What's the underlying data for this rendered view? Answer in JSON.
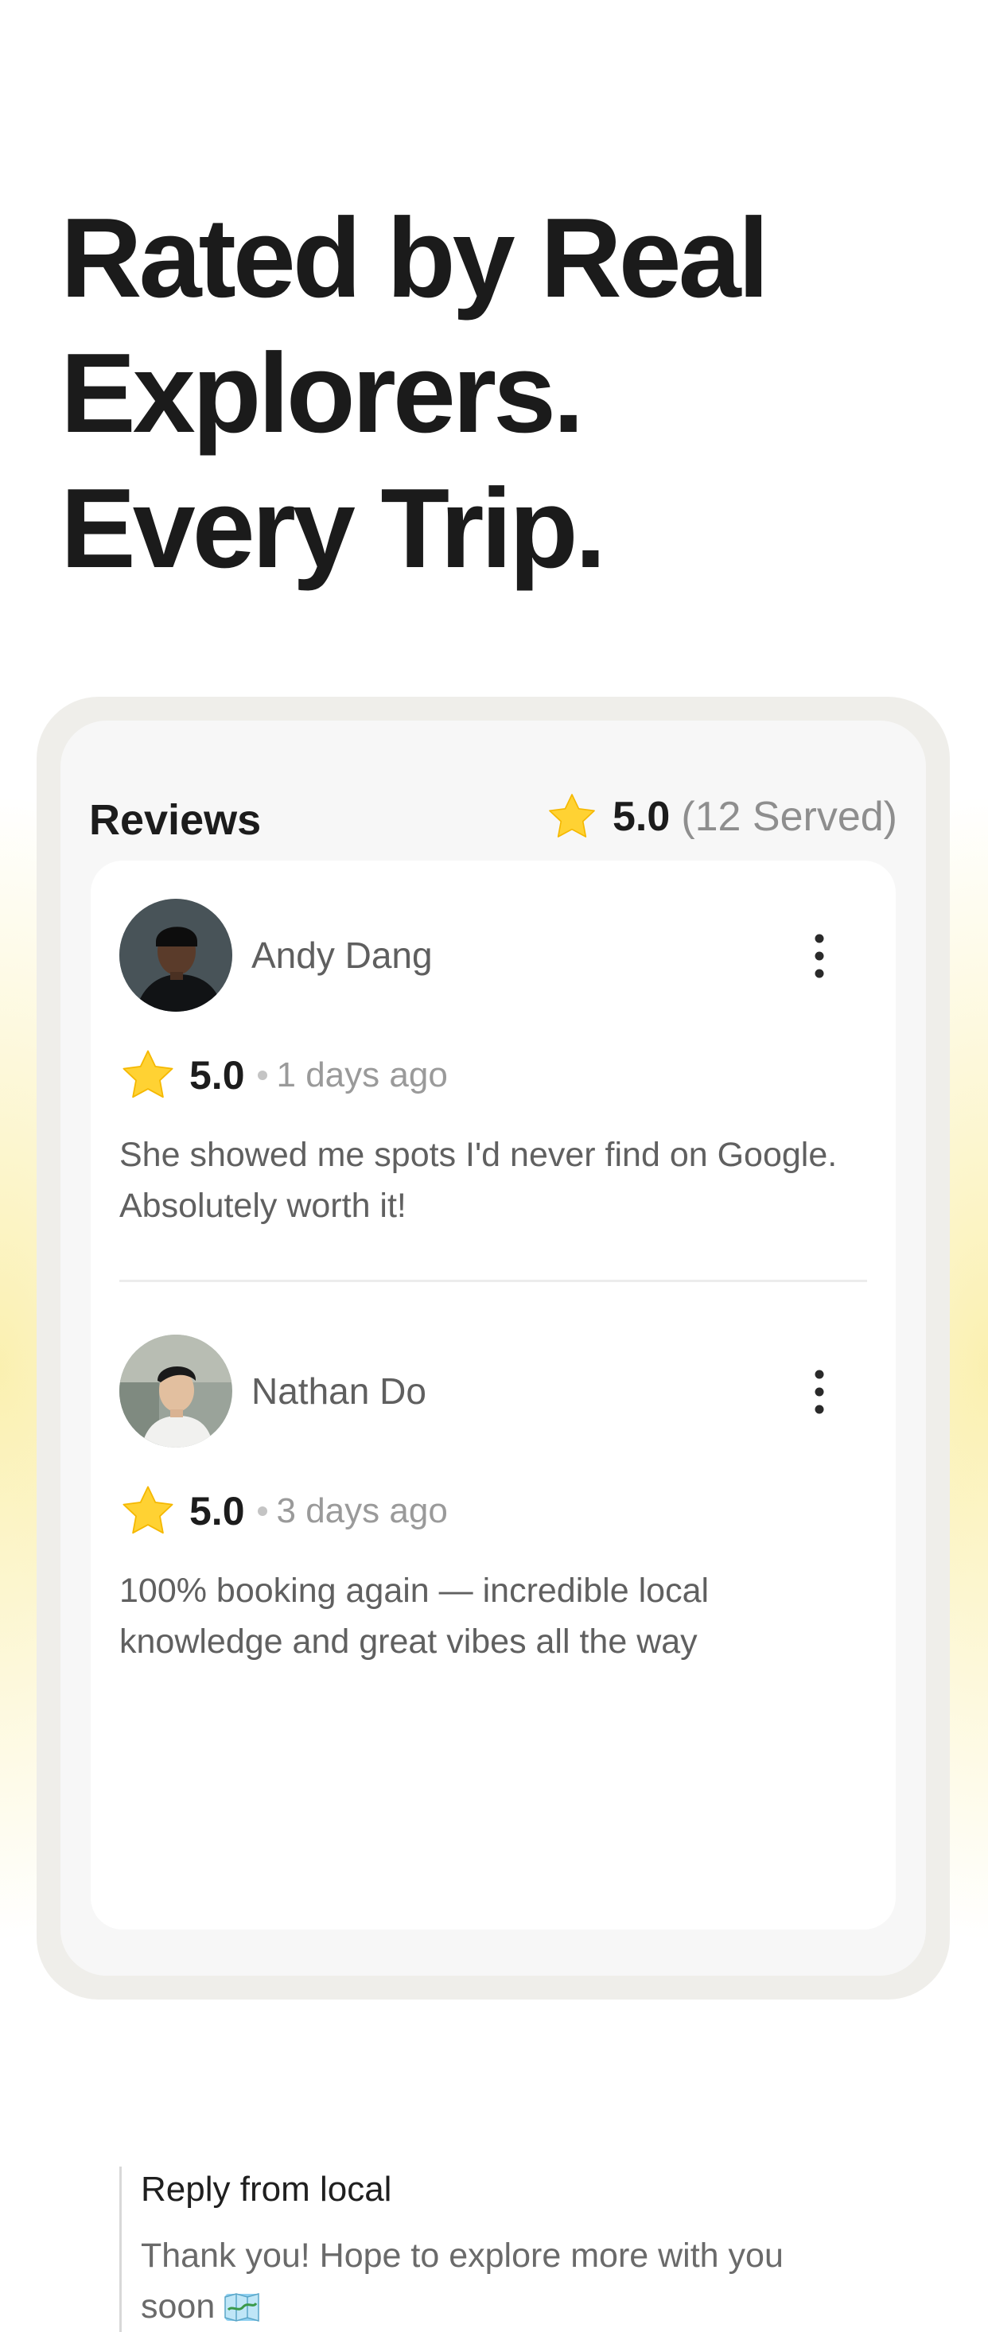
{
  "headline": {
    "lines": [
      "Rated by Real",
      "Explorers.",
      "Every Trip."
    ]
  },
  "reviews_card": {
    "title": "Reviews",
    "average_rating": "5.0",
    "served_count": "(12 Served)",
    "icons": {
      "rating_star": "star-icon",
      "more_menu": "more-vertical-icon",
      "map": "map-icon"
    },
    "colors": {
      "star": "#FFD233",
      "headline": "#1B1B1B",
      "accent_glow": "#F6E27A"
    },
    "reviews": [
      {
        "name": "Andy Dang",
        "rating": "5.0",
        "time_ago": "1 days ago",
        "text": "She showed me spots I'd never find on Google. Absolutely worth it!"
      },
      {
        "name": "Nathan Do",
        "rating": "5.0",
        "time_ago": "3 days ago",
        "text": "100% booking again — incredible local knowledge and great vibes all the way",
        "reply": {
          "title": "Reply from local",
          "text": "Thank you! Hope to explore more with you soon"
        }
      }
    ]
  }
}
